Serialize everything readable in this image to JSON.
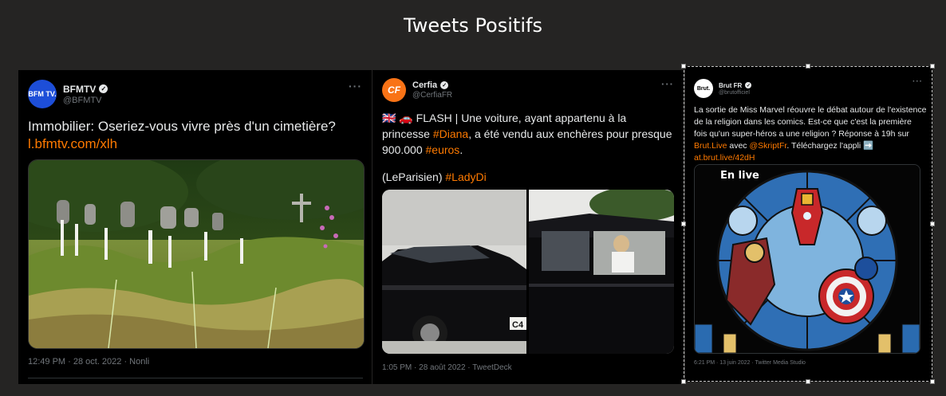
{
  "slide": {
    "title": "Tweets Positifs"
  },
  "tweets": [
    {
      "account_name": "BFMTV",
      "handle": "@BFMTV",
      "avatar_text": "BFM TV.",
      "text": "Immobilier: Oseriez-vous vivre près d'un cimetière?",
      "link": "l.bfmtv.com/xlh",
      "footer": "12:49 PM · 28 oct. 2022 · Nonli"
    },
    {
      "account_name": "Cerfia",
      "handle": "@CerfiaFR",
      "avatar_text": "CF",
      "flag_emoji": "🇬🇧 🚗",
      "text_part1": "FLASH | Une voiture, ayant appartenu à la princesse",
      "hashtag1": "#Diana",
      "text_part2": ", a été vendu aux enchères pour presque 900.000",
      "hashtag2": "#euros",
      "text_part3": ".",
      "credit": "(LeParisien)",
      "hashtag3": "#LadyDi",
      "plate_text": "C4",
      "footer": "1:05 PM · 28 août 2022 · TweetDeck"
    },
    {
      "account_name": "Brut FR",
      "handle": "@brutofficiel",
      "avatar_text": "Brut.",
      "text_part1": "La sortie de Miss Marvel réouvre le débat autour de l'existence de la religion dans les comics. Est-ce que c'est la première fois qu'un super-héros a une religion ? Réponse à 19h sur",
      "link1": "Brut.Live",
      "text_part2": "avec",
      "link2": "@SkriptFr",
      "text_part3": ". Téléchargez l'appli",
      "arrow_emoji": "➡️",
      "link3": "at.brut.live/42dH",
      "media_badge": "En live",
      "footer": "6:21 PM · 13 juin 2022 · Twitter Media Studio"
    }
  ],
  "colors": {
    "accent": "#ff7a00",
    "background": "#252423",
    "card": "#000000"
  }
}
